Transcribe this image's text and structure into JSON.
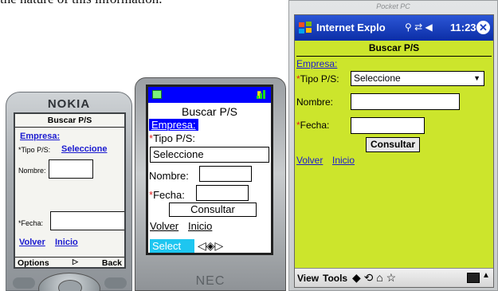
{
  "caption": {
    "text": "the nature of this information."
  },
  "nokia": {
    "brand": "NOKIA",
    "title": "Buscar P/S",
    "empresa": "Empresa:",
    "tipo_label": "*Tipo P/S:",
    "tipo_value": "Seleccione",
    "nombre_label": "Nombre:",
    "fecha_label": "*Fecha:",
    "volver": "Volver",
    "inicio": "Inicio",
    "softkey_left": "Options",
    "softkey_center": "▷",
    "softkey_right": "Back"
  },
  "nec": {
    "brand": "NEC",
    "title": "Buscar P/S",
    "empresa": "Empresa:",
    "tipo_label": "Tipo P/S:",
    "tipo_value": "Seleccione",
    "nombre_label": "Nombre:",
    "fecha_label": "Fecha:",
    "consultar": "Consultar",
    "volver": "Volver",
    "inicio": "Inicio",
    "softkey_left": "Select",
    "nav_glyph": "◁◈▷",
    "required_mark": "*"
  },
  "pocketpc": {
    "brand": "Pocket PC",
    "app_title": "Internet Explo",
    "status_icons": "⚲ ⇄ ◀ ",
    "time": "11:23",
    "close_glyph": "✕",
    "title": "Buscar P/S",
    "empresa": "Empresa:",
    "required_mark": "*",
    "tipo_label": "Tipo P/S:",
    "tipo_value": "Seleccione",
    "nombre_label": "Nombre:",
    "fecha_label": "Fecha:",
    "consultar": "Consultar",
    "volver": "Volver",
    "inicio": "Inicio",
    "menu_view": "View",
    "menu_tools": "Tools",
    "nav_icons": "◆ ⟲ ⌂ ☆"
  },
  "colors": {
    "pocketpc_bg": "#cce52c",
    "nec_status": "#0000ff",
    "link_blue": "#1a1ad0",
    "nec_select": "#1ec6f0",
    "required_red": "#e02020"
  }
}
